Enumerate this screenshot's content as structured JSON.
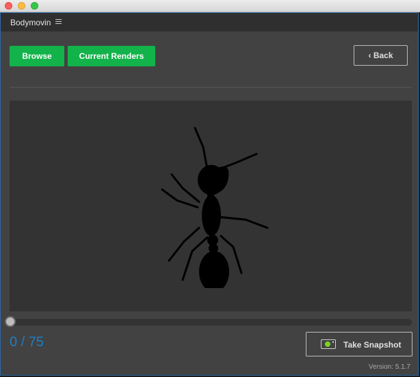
{
  "window": {
    "title": ""
  },
  "header": {
    "title": "Bodymovin",
    "menu_icon": "hamburger-menu-icon"
  },
  "toolbar": {
    "browse_label": "Browse",
    "current_renders_label": "Current Renders",
    "back_label": "‹ Back"
  },
  "preview": {
    "animation_icon": "ant-silhouette"
  },
  "player": {
    "current_frame": 0,
    "total_frames": 75,
    "frame_text": "0 / 75",
    "progress": 0.0
  },
  "snapshot": {
    "label": "Take Snapshot",
    "icon": "camera-icon"
  },
  "footer": {
    "version_text": "Version: 5.1.7"
  },
  "colors": {
    "accent_green": "#12b34a",
    "frame_counter": "#1d7fc4",
    "panel_bg": "#424242",
    "preview_bg": "#333333"
  }
}
